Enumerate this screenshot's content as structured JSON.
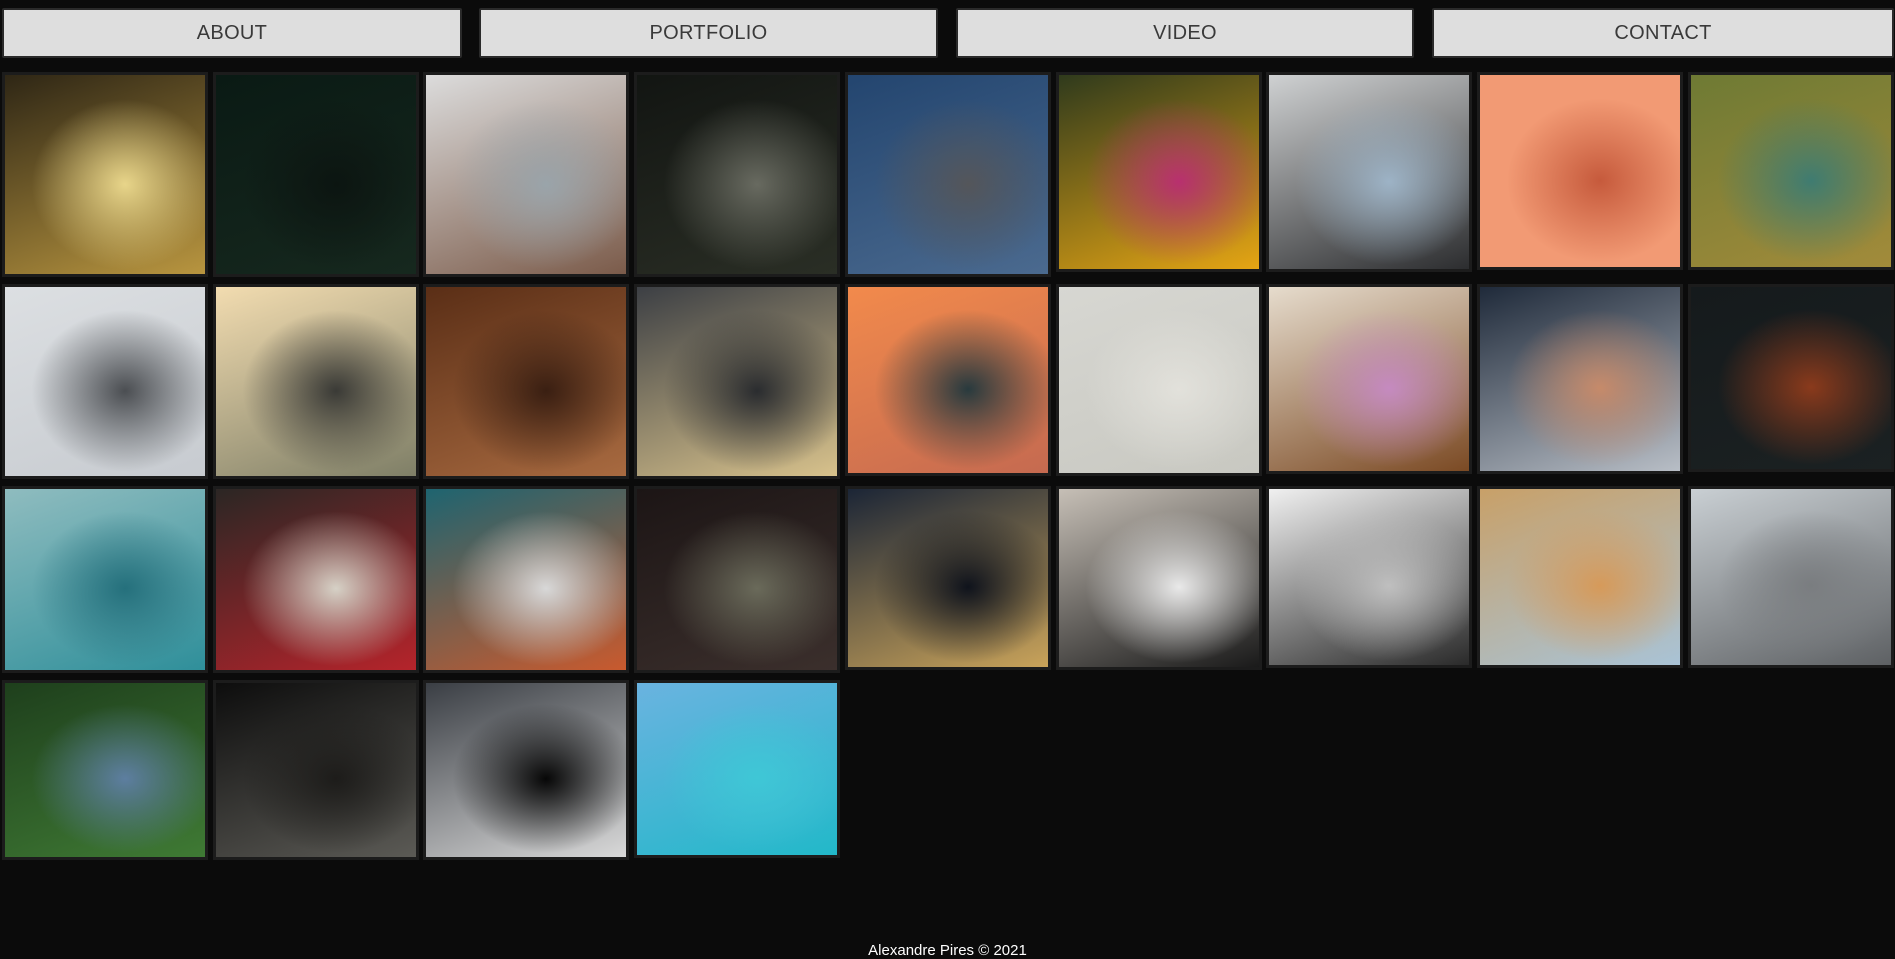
{
  "nav": {
    "about": "ABOUT",
    "portfolio": "PORTFOLIO",
    "video": "VIDEO",
    "contact": "CONTACT"
  },
  "gallery": [
    {
      "name": "photo-subway-escalator",
      "colors": [
        "#2e2615",
        "#b8953f",
        "#e8d58a"
      ]
    },
    {
      "name": "photo-dark-foliage-tree",
      "colors": [
        "#0a1a14",
        "#16281e",
        "#0c1511"
      ]
    },
    {
      "name": "photo-tattooed-hand-tea",
      "colors": [
        "#dcdcdc",
        "#7b5b4a",
        "#9aa4aa"
      ]
    },
    {
      "name": "photo-forest-waterfall",
      "colors": [
        "#121512",
        "#2a2e25",
        "#686a60"
      ]
    },
    {
      "name": "photo-icy-cliffs",
      "colors": [
        "#23456f",
        "#4b6a8f",
        "#54565a"
      ]
    },
    {
      "name": "photo-flower-bouquet",
      "colors": [
        "#2f3a1c",
        "#e5a514",
        "#b8306f"
      ]
    },
    {
      "name": "photo-man-leather-jacket",
      "colors": [
        "#cfd1d2",
        "#2c2d2f",
        "#9db3c6"
      ]
    },
    {
      "name": "photo-feather-coral",
      "colors": [
        "#f29a74",
        "#f29a74",
        "#c65a3c"
      ]
    },
    {
      "name": "photo-aerial-coastline",
      "colors": [
        "#6e7a34",
        "#a28b3a",
        "#3f7c71"
      ]
    },
    {
      "name": "photo-misty-mountain",
      "colors": [
        "#dcdfe2",
        "#c7cbd0",
        "#4b4e52"
      ]
    },
    {
      "name": "photo-tuscany-hills",
      "colors": [
        "#f2dcb0",
        "#7f7f67",
        "#3a3a36"
      ]
    },
    {
      "name": "photo-wavy-wood",
      "colors": [
        "#5a2e16",
        "#a86a40",
        "#3a1f12"
      ]
    },
    {
      "name": "photo-calligraphy-sign",
      "colors": [
        "#3c3f44",
        "#d8c28c",
        "#2a2c2f"
      ]
    },
    {
      "name": "photo-sunset-valley",
      "colors": [
        "#f28a4c",
        "#c56a50",
        "#283a3e"
      ]
    },
    {
      "name": "photo-beach-walker",
      "colors": [
        "#d7d7d2",
        "#c8c8c1",
        "#e2e1db"
      ]
    },
    {
      "name": "photo-cake-slice",
      "colors": [
        "#e6dccd",
        "#7b4a24",
        "#c58ac0"
      ]
    },
    {
      "name": "photo-woman-street-coat",
      "colors": [
        "#1f2a3a",
        "#b8bec6",
        "#c68a6a"
      ]
    },
    {
      "name": "photo-autumn-leaf-dark",
      "colors": [
        "#151a1c",
        "#1b2122",
        "#8a3a1c"
      ]
    },
    {
      "name": "photo-aerial-ocean-shore",
      "colors": [
        "#8fbcbf",
        "#2f8f9a",
        "#25707c"
      ]
    },
    {
      "name": "photo-red-jacket-stretch",
      "colors": [
        "#2b2624",
        "#b5242b",
        "#d6d1c6"
      ]
    },
    {
      "name": "photo-statue-flag",
      "colors": [
        "#1e6470",
        "#c95a2e",
        "#d8d8d8"
      ]
    },
    {
      "name": "photo-fern-leaf",
      "colors": [
        "#1c1515",
        "#3b2f2c",
        "#6a6a5a"
      ]
    },
    {
      "name": "photo-night-city-street",
      "colors": [
        "#1b2536",
        "#c9a35a",
        "#0f131c"
      ]
    },
    {
      "name": "photo-couple-embrace",
      "colors": [
        "#c6bfb6",
        "#1a1a1a",
        "#e9e9e9"
      ]
    },
    {
      "name": "photo-snowy-stream",
      "colors": [
        "#f0f0f0",
        "#2a2a2a",
        "#bfbfbf"
      ]
    },
    {
      "name": "photo-old-town-buildings",
      "colors": [
        "#c8a068",
        "#a9c3d6",
        "#d69a5a"
      ]
    },
    {
      "name": "photo-man-road-stop",
      "colors": [
        "#c9cfd3",
        "#5e6164",
        "#7a7d80"
      ]
    },
    {
      "name": "photo-river-gorge-aerial",
      "colors": [
        "#1e3f1c",
        "#3f7a34",
        "#5d7ea0"
      ]
    },
    {
      "name": "photo-temple-columns",
      "colors": [
        "#0d0d0d",
        "#5b5a55",
        "#1d1c1a"
      ]
    },
    {
      "name": "photo-stormy-mountain",
      "colors": [
        "#3a3e44",
        "#d9d9d9",
        "#070707"
      ]
    },
    {
      "name": "photo-tropical-island-sea",
      "colors": [
        "#6ab3e0",
        "#22b8c9",
        "#3fc7d6"
      ]
    }
  ],
  "footer": {
    "copyright": "Alexandre Pires © 2021"
  }
}
